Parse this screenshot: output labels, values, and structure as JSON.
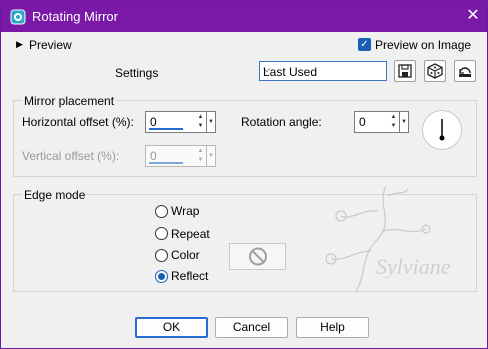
{
  "window": {
    "title": "Rotating Mirror",
    "close_glyph": "✕"
  },
  "header": {
    "preview_toggle": "Preview",
    "preview_on_image": "Preview on Image",
    "preview_on_image_checked": true,
    "settings_label": "Settings",
    "settings_value": "Last Used"
  },
  "mirror": {
    "group_label": "Mirror placement",
    "horizontal_label": "Horizontal offset (%):",
    "horizontal_value": "0",
    "vertical_label": "Vertical offset (%):",
    "vertical_value": "0",
    "rotation_label": "Rotation angle:",
    "rotation_value": "0"
  },
  "edge": {
    "group_label": "Edge mode",
    "options": [
      "Wrap",
      "Repeat",
      "Color",
      "Reflect"
    ],
    "selected": "Reflect"
  },
  "watermark": {
    "text": "Sylviane"
  },
  "buttons": {
    "ok": "OK",
    "cancel": "Cancel",
    "help": "Help"
  },
  "colors": {
    "titlebar": "#7a19a8",
    "accent": "#2a6bd1"
  }
}
